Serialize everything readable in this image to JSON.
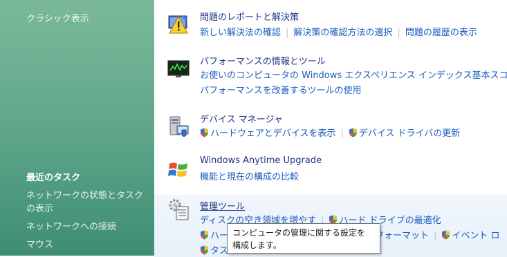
{
  "sidebar": {
    "classic_view": "クラシック表示",
    "recent_tasks_title": "最近のタスク",
    "tasks": [
      "ネットワークの状態とタスクの表示",
      "ネットワークへの接続",
      "マウス"
    ]
  },
  "categories": {
    "problems": {
      "title": "問題のレポートと解決策",
      "links": [
        "新しい解決法の確認",
        "解決策の確認方法の選択",
        "問題の履歴の表示"
      ]
    },
    "performance": {
      "title": "パフォーマンスの情報とツール",
      "links": [
        "お使いのコンピュータの Windows エクスペリエンス インデックス基本スコ",
        "パフォーマンスを改善するツールの使用"
      ]
    },
    "devices": {
      "title": "デバイス マネージャ",
      "links": [
        "ハードウェアとデバイスを表示",
        "デバイス ドライバの更新"
      ]
    },
    "anytime": {
      "title": "Windows Anytime Upgrade",
      "links": [
        "機能と現在の構成の比較"
      ]
    },
    "admin": {
      "title": "管理ツール",
      "links": [
        "ディスクの空き領域を増やす",
        "ハード ドライブの最適化",
        "ハー",
        "フォーマット",
        "イベント ロ",
        "タス"
      ]
    }
  },
  "tooltip": {
    "line1": "コンピュータの管理に関する設定を",
    "line2": "構成します。"
  },
  "colors": {
    "sidebar_green": "#63a88c",
    "link_blue": "#1a5bbf",
    "title_blue": "#1e3287",
    "hover_bg": "#e8f0fa"
  }
}
